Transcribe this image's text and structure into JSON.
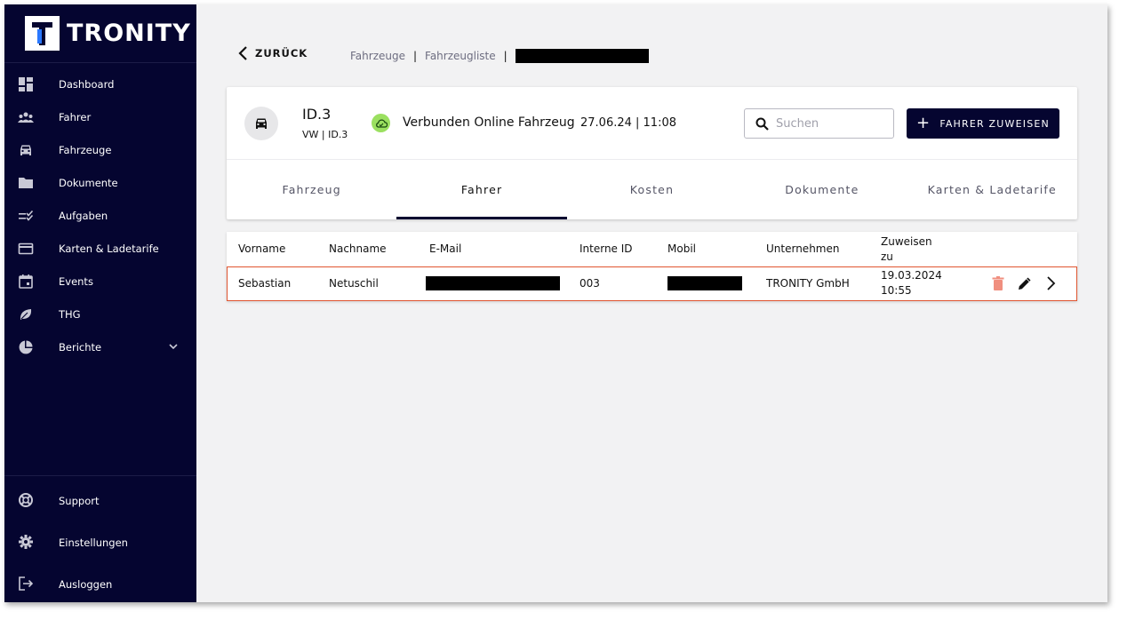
{
  "logo": {
    "letter": "T",
    "name": "TRONITY"
  },
  "sidebar": {
    "items": [
      {
        "label": "Dashboard",
        "icon": "dashboard-icon"
      },
      {
        "label": "Fahrer",
        "icon": "people-icon"
      },
      {
        "label": "Fahrzeuge",
        "icon": "car-icon"
      },
      {
        "label": "Dokumente",
        "icon": "folder-icon"
      },
      {
        "label": "Aufgaben",
        "icon": "checklist-icon"
      },
      {
        "label": "Karten & Ladetarife",
        "icon": "card-icon"
      },
      {
        "label": "Events",
        "icon": "calendar-icon"
      },
      {
        "label": "THG",
        "icon": "leaf-icon"
      },
      {
        "label": "Berichte",
        "icon": "pie-chart-icon"
      }
    ],
    "bottom": [
      {
        "label": "Support",
        "icon": "lifebuoy-icon"
      },
      {
        "label": "Einstellungen",
        "icon": "gear-icon"
      },
      {
        "label": "Ausloggen",
        "icon": "logout-icon"
      }
    ]
  },
  "breadcrumb": {
    "back_label": "ZURÜCK",
    "crumbs": [
      "Fahrzeuge",
      "Fahrzeugliste"
    ],
    "separator": "|"
  },
  "vehicle": {
    "name": "ID.3",
    "subtitle": "VW | ID.3",
    "status": "Verbunden Online Fahrzeug",
    "timestamp": "27.06.24 | 11:08"
  },
  "search": {
    "placeholder": "Suchen",
    "value": ""
  },
  "assign_button": {
    "label": "FAHRER ZUWEISEN"
  },
  "tabs": [
    {
      "label": "Fahrzeug",
      "active": false
    },
    {
      "label": "Fahrer",
      "active": true
    },
    {
      "label": "Kosten",
      "active": false
    },
    {
      "label": "Dokumente",
      "active": false
    },
    {
      "label": "Karten & Ladetarife",
      "active": false
    }
  ],
  "table": {
    "headers": [
      "Vorname",
      "Nachname",
      "E-Mail",
      "Interne ID",
      "Mobil",
      "Unternehmen",
      "Zuweisen zu"
    ],
    "rows": [
      {
        "vorname": "Sebastian",
        "nachname": "Netuschil",
        "interne_id": "003",
        "unternehmen": "TRONITY GmbH",
        "zuweisen_zu": "19.03.2024 10:55"
      }
    ]
  },
  "colors": {
    "sidebar": "#050530",
    "accent": "#050530",
    "status_online": "#9be060",
    "row_highlight": "#e05530",
    "delete": "#f08f7f"
  }
}
